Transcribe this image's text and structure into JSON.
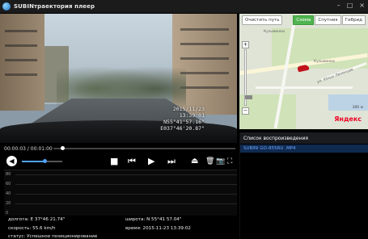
{
  "window": {
    "title": "SUBINтраектория плеер",
    "minimize": "–",
    "maximize": "□",
    "close": "×"
  },
  "video": {
    "osd_date": "2015/11/23",
    "osd_time": "13:39:01",
    "osd_lat": "N55°41'57.16\"",
    "osd_lon": "E037°46'20.87\""
  },
  "playback": {
    "time": "00:00:03 / 00:01:00",
    "progress": 0.05,
    "volume": 0.55
  },
  "controls": {
    "stop": "■",
    "prev": "⏮",
    "play": "▶",
    "next": "⏭",
    "eject": "⏏",
    "delete": "🗑",
    "snapshot": "📷",
    "fullscreen": "⛶"
  },
  "graph": {
    "ticks": [
      "80",
      "60",
      "40",
      "20",
      "0"
    ]
  },
  "info": {
    "longitude": "долгота: E 37°46 21.74\"",
    "latitude": "широта: N 55°41 57.04\"",
    "speed": "скорость: 55.6 km/h",
    "time": "время: 2015-11-23 13:39:02",
    "status": "статус: Успешное позиционирование"
  },
  "map": {
    "clear_path": "Очистить путь",
    "types": [
      "Схема",
      "Спутник",
      "Гибрид"
    ],
    "active_type": "Схема",
    "labels": {
      "area": "Кузьминки",
      "area2": "Кузьминки",
      "street": "ул. Юных Ленинцев"
    },
    "scale": "300 м",
    "brand": "Яндекс"
  },
  "playlist": {
    "header": "Список воспроизведения",
    "items": [
      "SUBINI GO-855RU .MP4"
    ]
  }
}
